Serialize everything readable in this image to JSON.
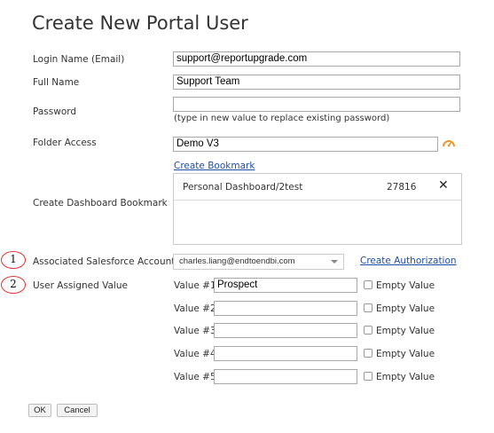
{
  "page": {
    "title": "Create New Portal User"
  },
  "form": {
    "login_label": "Login Name (Email)",
    "login_value": "support@reportupgrade.com",
    "fullname_label": "Full Name",
    "fullname_value": "Support Team",
    "password_label": "Password",
    "password_value": "",
    "password_hint": "(type in new value to replace existing password)",
    "folder_label": "Folder Access",
    "folder_value": "Demo V3",
    "folder_icon": "dashboard-gauge-icon",
    "create_bookmark_link": "Create Bookmark",
    "bookmark_label": "Create Dashboard Bookmark",
    "bookmarks": [
      {
        "name": "Personal Dashboard/2test",
        "id": "27816",
        "remove": "✕"
      }
    ],
    "salesforce_label": "Associated Salesforce Account",
    "salesforce_value": "charles.liang@endtoendbi.com",
    "create_authorization_link": "Create Authorization",
    "user_value_label": "User Assigned Value",
    "values": [
      {
        "label": "Value #1",
        "value": "Prospect",
        "empty_label": "Empty Value",
        "empty_checked": false
      },
      {
        "label": "Value #2",
        "value": "",
        "empty_label": "Empty Value",
        "empty_checked": false
      },
      {
        "label": "Value #3",
        "value": "",
        "empty_label": "Empty Value",
        "empty_checked": false
      },
      {
        "label": "Value #4",
        "value": "",
        "empty_label": "Empty Value",
        "empty_checked": false
      },
      {
        "label": "Value #5",
        "value": "",
        "empty_label": "Empty Value",
        "empty_checked": false
      }
    ]
  },
  "annotations": {
    "marker1": "1",
    "marker2": "2",
    "marker_color": "#e03030"
  },
  "buttons": {
    "ok": "OK",
    "cancel": "Cancel"
  }
}
